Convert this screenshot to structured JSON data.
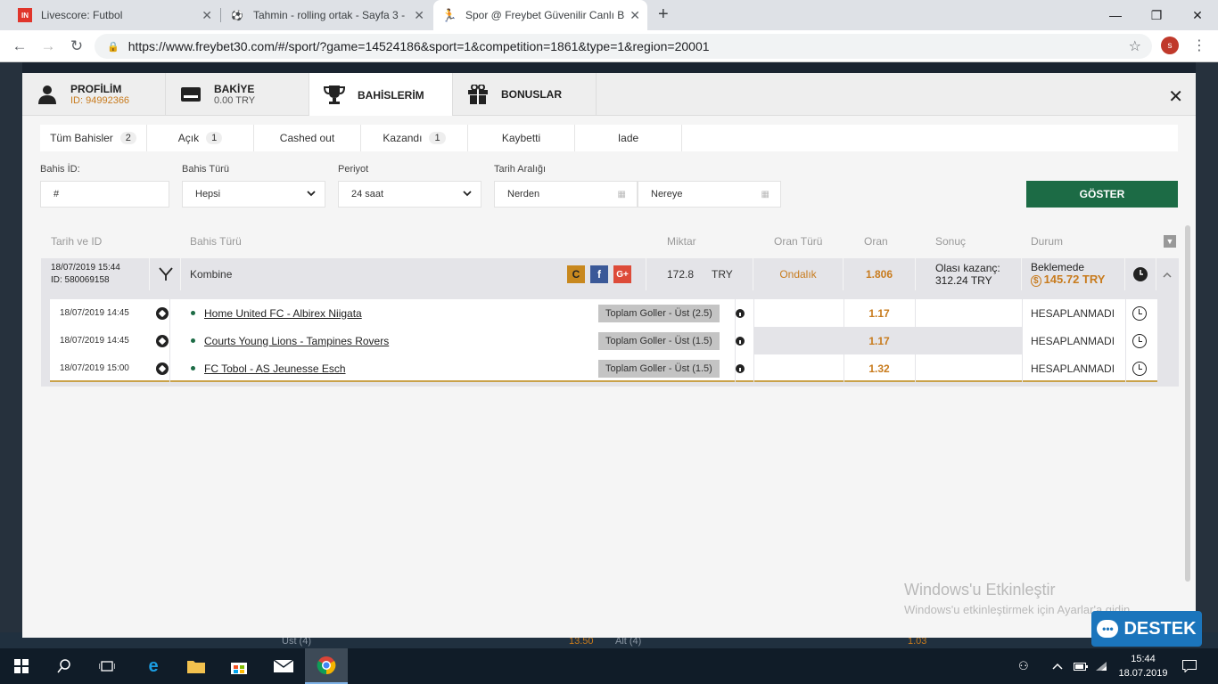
{
  "browser": {
    "tabs": [
      {
        "title": "Livescore: Futbol",
        "favicon": "365-logo"
      },
      {
        "title": "Tahmin - rolling ortak - Sayfa 3 -",
        "favicon": "soccer-ball-icon"
      },
      {
        "title": "Spor @ Freybet Güvenilir Canlı B",
        "favicon": "runner-icon"
      }
    ],
    "url": "https://www.freybet30.com/#/sport/?game=14524186&sport=1&competition=1861&type=1&region=20001",
    "profile_initial": "s"
  },
  "modal": {
    "tabs": [
      {
        "title": "PROFİLİM",
        "sub": "ID: 94992366"
      },
      {
        "title": "BAKİYE",
        "sub": "0.00 TRY"
      },
      {
        "title": "BAHİSLERİM",
        "sub": ""
      },
      {
        "title": "BONUSLAR",
        "sub": ""
      }
    ],
    "filter_tabs": [
      {
        "label": "Tüm Bahisler",
        "count": "2"
      },
      {
        "label": "Açık",
        "count": "1"
      },
      {
        "label": "Cashed out",
        "count": ""
      },
      {
        "label": "Kazandı",
        "count": "1"
      },
      {
        "label": "Kaybetti",
        "count": ""
      },
      {
        "label": "Iade",
        "count": ""
      }
    ],
    "fields": {
      "bet_id_label": "Bahis İD:",
      "bet_id_value": "#",
      "bet_type_label": "Bahis Türü",
      "bet_type_value": "Hepsi",
      "period_label": "Periyot",
      "period_value": "24 saat",
      "date_range_label": "Tarih Aralığı",
      "from_value": "Nerden",
      "to_value": "Nereye",
      "show_button": "GÖSTER"
    },
    "columns": [
      "Tarih ve ID",
      "Bahis Türü",
      "Miktar",
      "Oran Türü",
      "Oran",
      "Sonuç",
      "Durum"
    ],
    "bet": {
      "datetime": "18/07/2019 15:44",
      "id": "ID: 580069158",
      "type": "Kombine",
      "amount": "172.8",
      "currency": "TRY",
      "odds_type": "Ondalık",
      "odds": "1.806",
      "result_label": "Olası kazanç:",
      "result_value": "312.24 TRY",
      "status": "Beklemede",
      "cashout": "145.72 TRY"
    },
    "selections": [
      {
        "datetime": "18/07/2019 14:45",
        "match": "Home United FC - Albirex Niigata",
        "market": "Toplam Goller - Üst (2.5)",
        "odds": "1.17",
        "status": "HESAPLANMADI"
      },
      {
        "datetime": "18/07/2019 14:45",
        "match": "Courts Young Lions - Tampines Rovers",
        "market": "Toplam Goller - Üst (1.5)",
        "odds": "1.17",
        "status": "HESAPLANMADI"
      },
      {
        "datetime": "18/07/2019 15:00",
        "match": "FC Tobol - AS Jeunesse Esch",
        "market": "Toplam Goller - Üst (1.5)",
        "odds": "1.32",
        "status": "HESAPLANMADI"
      }
    ]
  },
  "background": {
    "strip_left": "Üst (4)",
    "strip_odd1": "13.50",
    "strip_mid": "Alt (4)",
    "strip_odd2": "1.03"
  },
  "watermark": {
    "line1": "Windows'u Etkinleştir",
    "line2": "Windows'u etkinleştirmek için Ayarlar'a gidin."
  },
  "support_button": "DESTEK",
  "taskbar": {
    "time": "15:44",
    "date": "18.07.2019"
  },
  "colors": {
    "accent_green": "#1c6b45",
    "odds_orange": "#c87b1d",
    "support_blue": "#1b75bc"
  }
}
